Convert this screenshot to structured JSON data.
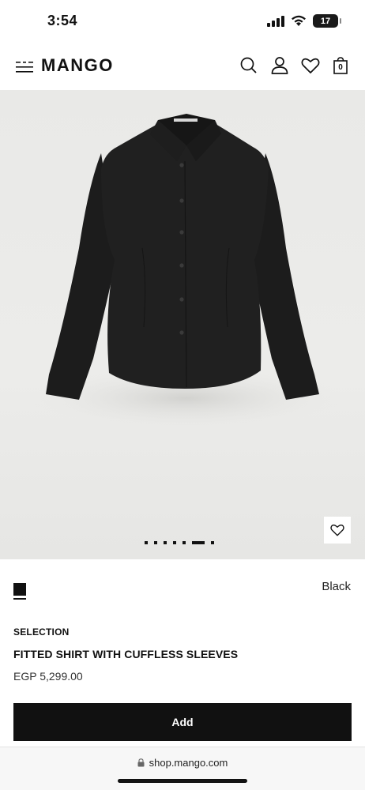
{
  "status": {
    "time": "3:54",
    "battery": "17"
  },
  "header": {
    "logo": "MANGO",
    "bag_count": "0"
  },
  "gallery": {
    "dot_count": 7,
    "active_dot": 5
  },
  "product": {
    "color_name": "Black",
    "color_hex": "#111111",
    "selection_label": "SELECTION",
    "title": "FITTED SHIRT WITH CUFFLESS SLEEVES",
    "price": "EGP 5,299.00",
    "add_label": "Add"
  },
  "browser": {
    "url": "shop.mango.com"
  },
  "icons": [
    "menu-icon",
    "search-icon",
    "user-icon",
    "heart-icon",
    "bag-icon",
    "lock-icon",
    "signal-icon",
    "wifi-icon",
    "battery-icon"
  ]
}
